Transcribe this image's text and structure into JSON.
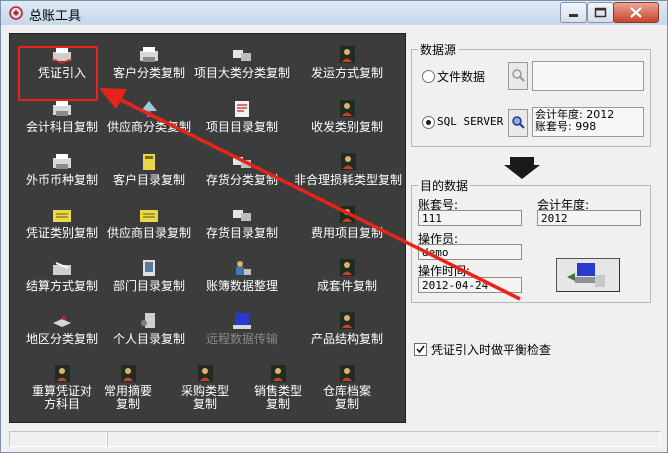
{
  "window": {
    "title": "总账工具"
  },
  "tools": [
    {
      "label": "凭证引入",
      "icon": "print-import-icon"
    },
    {
      "label": "客户分类复制",
      "icon": "printer-icon"
    },
    {
      "label": "项目大类分类复制",
      "icon": "copy-icon"
    },
    {
      "label": "发运方式复制",
      "icon": "gear-person-icon"
    },
    {
      "label": "会计科目复制",
      "icon": "printer-icon"
    },
    {
      "label": "供应商分类复制",
      "icon": "tree-icon"
    },
    {
      "label": "项目目录复制",
      "icon": "document-icon"
    },
    {
      "label": "收发类别复制",
      "icon": "gear-person-icon"
    },
    {
      "label": "外币币种复制",
      "icon": "printer-icon"
    },
    {
      "label": "客户目录复制",
      "icon": "book-icon"
    },
    {
      "label": "存货分类复制",
      "icon": "copy-icon"
    },
    {
      "label": "非合理损耗类型复制",
      "icon": "gear-person-icon"
    },
    {
      "label": "凭证类别复制",
      "icon": "folder-icon"
    },
    {
      "label": "供应商目录复制",
      "icon": "folder-icon"
    },
    {
      "label": "存货目录复制",
      "icon": "copy-icon"
    },
    {
      "label": "费用项目复制",
      "icon": "gear-person-icon"
    },
    {
      "label": "结算方式复制",
      "icon": "toolbox-icon"
    },
    {
      "label": "部门目录复制",
      "icon": "book-icon"
    },
    {
      "label": "账簿数据整理",
      "icon": "person-icon"
    },
    {
      "label": "成套件复制",
      "icon": "gear-person-icon"
    },
    {
      "label": "地区分类复制",
      "icon": "map-icon"
    },
    {
      "label": "个人目录复制",
      "icon": "person-icon"
    },
    {
      "label": "远程数据传输",
      "icon": "transfer-icon"
    },
    {
      "label": "产品结构复制",
      "icon": "gear-person-icon"
    },
    {
      "label": "重算凭证对方科目",
      "icon": "gear-person-icon"
    },
    {
      "label": "常用摘要复制",
      "icon": "gear-person-icon"
    },
    {
      "label": "采购类型复制",
      "icon": "gear-person-icon"
    },
    {
      "label": "销售类型复制",
      "icon": "gear-person-icon"
    },
    {
      "label": "仓库档案复制",
      "icon": "gear-person-icon"
    }
  ],
  "source": {
    "group_title": "数据源",
    "file_radio_label": "文件数据",
    "sql_radio_label": "SQL SERVER",
    "sql_info_year": "会计年度: 2012",
    "sql_info_account": "账套号: 998",
    "selected": "SQL SERVER"
  },
  "target": {
    "group_title": "目的数据",
    "account_label": "账套号:",
    "account_value": "111",
    "year_label": "会计年度:",
    "year_value": "2012",
    "operator_label": "操作员:",
    "operator_value": "demo",
    "time_label": "操作时间:",
    "time_value": "2012-04-24"
  },
  "balance_check": {
    "label": "凭证引入时做平衡检查",
    "checked": true
  },
  "colors": {
    "panel": "#3c3c3c",
    "highlight": "#e8241a",
    "arrow": "#e8241a"
  }
}
